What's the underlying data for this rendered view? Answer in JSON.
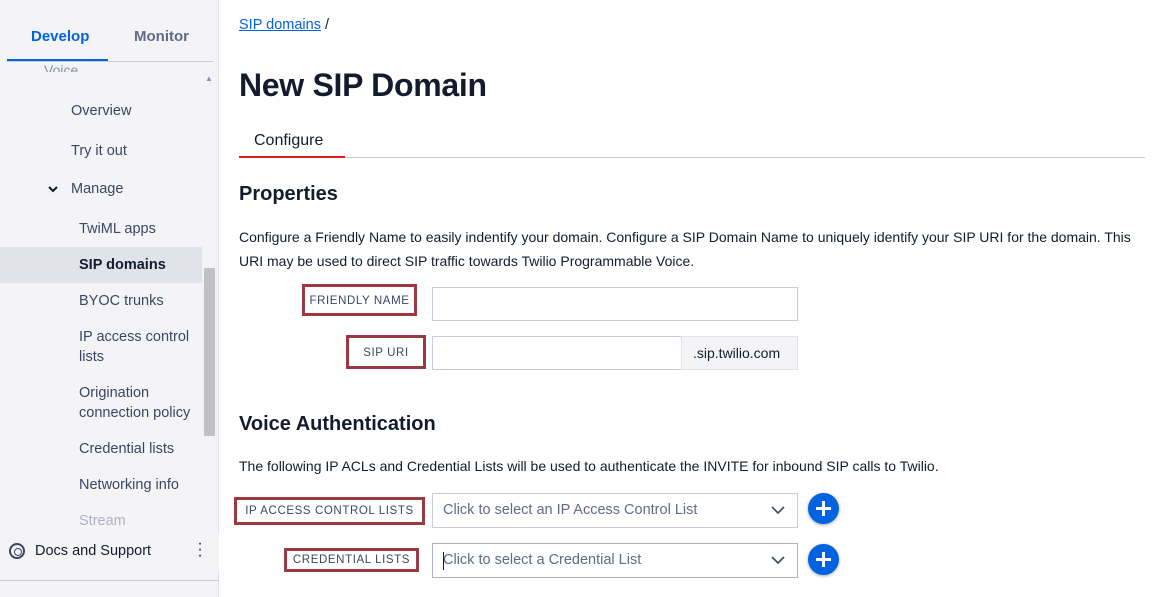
{
  "sidebar": {
    "tabs": [
      {
        "label": "Develop",
        "active": true
      },
      {
        "label": "Monitor",
        "active": false
      }
    ],
    "cut_item": "Voice",
    "items": {
      "overview": "Overview",
      "try_it_out": "Try it out",
      "manage": "Manage",
      "twiml_apps": "TwiML apps",
      "sip_domains": "SIP domains",
      "byoc_trunks": "BYOC trunks",
      "ip_access_control_lists": "IP access control lists",
      "origination_connection_policy": "Origination connection policy",
      "credential_lists": "Credential lists",
      "networking_info": "Networking info",
      "stream": "Stream"
    },
    "active_item": "SIP domains",
    "footer": {
      "docs_label": "Docs and Support",
      "more_icon": "kebab-vertical-icon"
    }
  },
  "breadcrumb": {
    "link": "SIP domains",
    "separator": "/"
  },
  "page_title": "New SIP Domain",
  "content_tabs": [
    {
      "label": "Configure",
      "active": true
    }
  ],
  "properties": {
    "title": "Properties",
    "description": "Configure a Friendly Name to easily indentify your domain. Configure a SIP Domain Name to uniquely identify your SIP URI for the domain. This URI may be used to direct SIP traffic towards Twilio Programmable Voice.",
    "friendly_name": {
      "label": "FRIENDLY NAME",
      "value": ""
    },
    "sip_uri": {
      "label": "SIP URI",
      "value": "",
      "suffix": ".sip.twilio.com"
    }
  },
  "voice_auth": {
    "title": "Voice Authentication",
    "description": "The following IP ACLs and Credential Lists will be used to authenticate the INVITE for inbound SIP calls to Twilio.",
    "ip_acl": {
      "label": "IP ACCESS CONTROL LISTS",
      "placeholder": "Click to select an IP Access Control List"
    },
    "credential_lists": {
      "label": "CREDENTIAL LISTS",
      "placeholder": "Click to select a Credential List"
    }
  },
  "colors": {
    "brand_blue": "#0263e0",
    "active_tab_red": "#d61f1f",
    "highlight_box": "#9c3a42",
    "sidebar_bg": "#f4f4f6"
  }
}
